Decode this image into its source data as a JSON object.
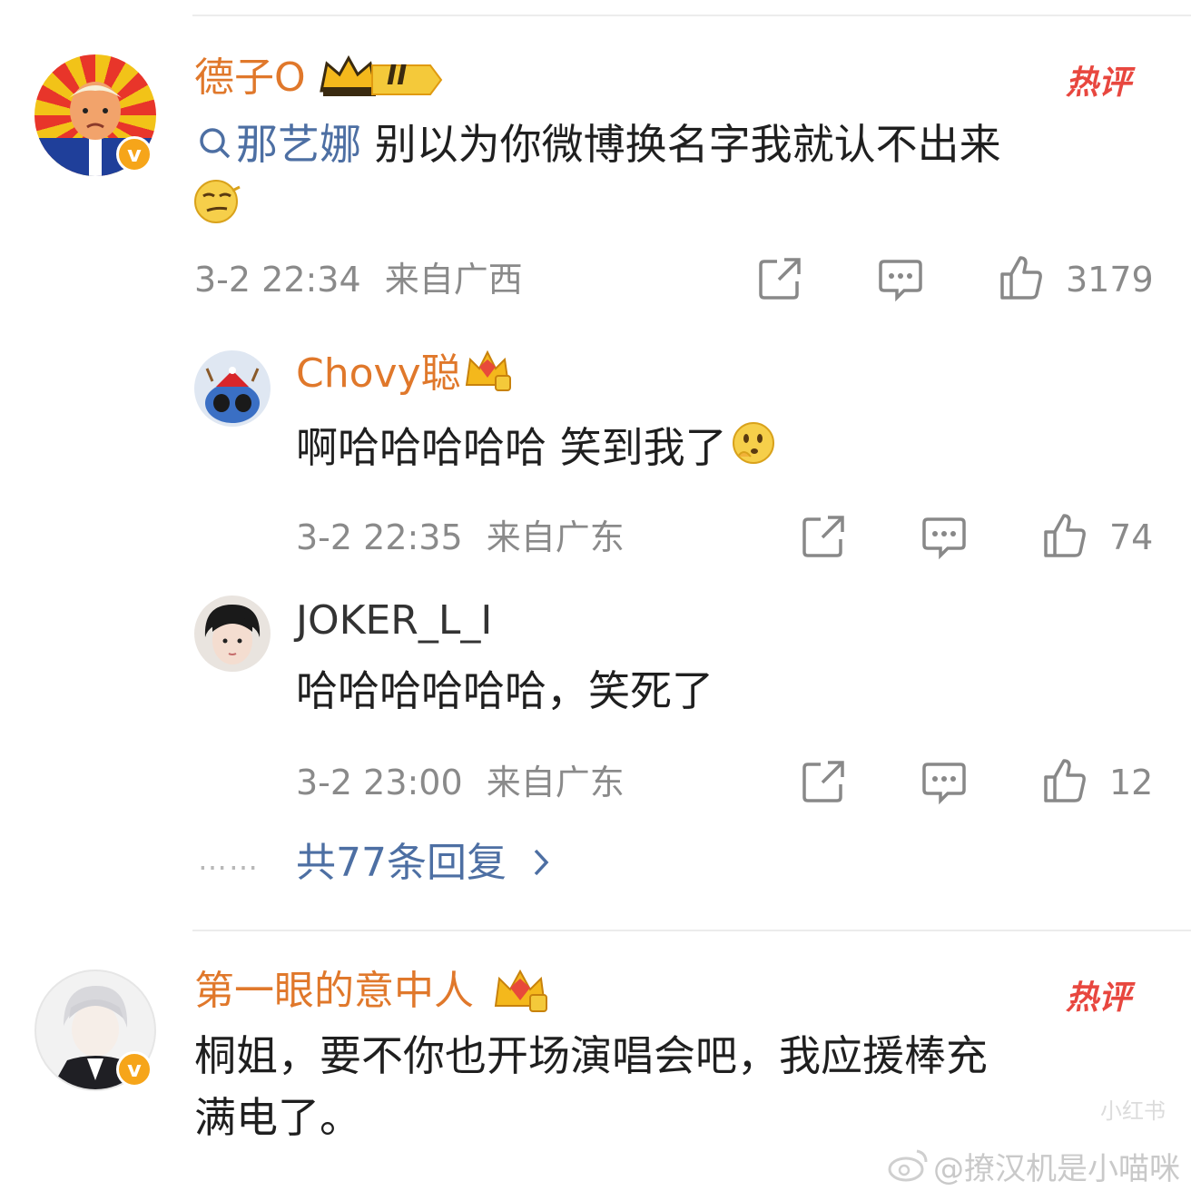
{
  "comments": [
    {
      "username": "德子O",
      "level_badge": "II",
      "hot_label": "热评",
      "mention": "那艺娜",
      "text": "别以为你微博换名字我就认不出来",
      "time": "3-2 22:34",
      "location": "来自广西",
      "likes": "3179",
      "replies": [
        {
          "username": "Chovy聪",
          "text": "啊哈哈哈哈哈 笑到我了",
          "time": "3-2 22:35",
          "location": "来自广东",
          "likes": "74"
        },
        {
          "username": "JOKER_L_I",
          "text": "哈哈哈哈哈哈，笑死了",
          "time": "3-2 23:00",
          "location": "来自广东",
          "likes": "12"
        }
      ],
      "more_replies": "共77条回复",
      "more_dots": "……"
    },
    {
      "username": "第一眼的意中人",
      "hot_label": "热评",
      "text_line1": "桐姐，要不你也开场演唱会吧，我应援棒充",
      "text_line2": "满电了。"
    }
  ],
  "watermark": "@撩汉机是小喵咪",
  "watermark_small": "小红书",
  "colors": {
    "username_orange": "#e0782b",
    "link_blue": "#4d6fa3",
    "hot_red": "#e8473f",
    "meta_gray": "#8a8a8a"
  }
}
